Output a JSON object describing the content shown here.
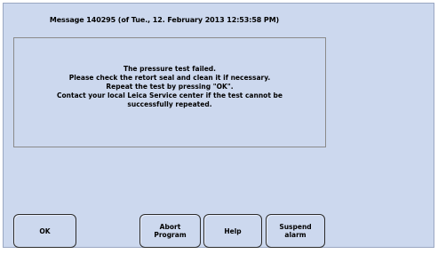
{
  "dialog": {
    "title": "Message 140295 (of Tue., 12. February 2013 12:53:58 PM)",
    "message_lines": [
      "The pressure test failed.",
      "Please check the retort seal and clean it if necessary.",
      "Repeat the test by pressing \"OK\".",
      "Contact your local Leica Service center if the test cannot be",
      "successfully repeated."
    ]
  },
  "buttons": {
    "ok": "OK",
    "abort": [
      "Abort",
      "Program"
    ],
    "help": "Help",
    "suspend": [
      "Suspend",
      "alarm"
    ]
  },
  "colors": {
    "background": "#ccd8ee",
    "border": "#2c2c2c"
  }
}
